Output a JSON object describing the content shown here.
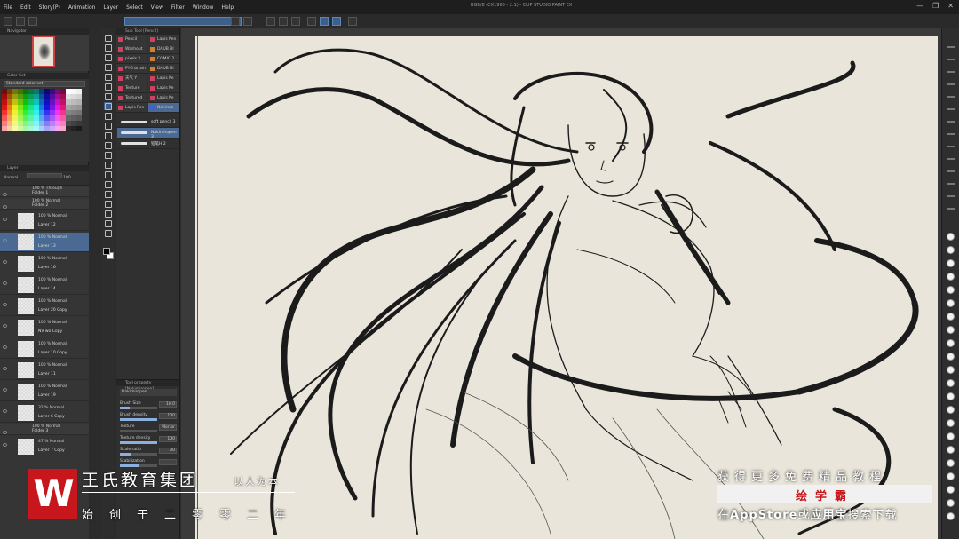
{
  "app": {
    "window_title": "RGB/8 (CX1966 - 2.1) - CLIP STUDIO PAINT EX",
    "menu": [
      "File",
      "Edit",
      "Story(P)",
      "Animation",
      "Layer",
      "Select",
      "View",
      "Filter",
      "Window",
      "Help"
    ],
    "window_controls": [
      "—",
      "❐",
      "✕"
    ]
  },
  "navigator": {
    "title": "Navigator"
  },
  "color_set": {
    "title": "Color Set",
    "selected_set": "Standard color set"
  },
  "layers_panel": {
    "title": "Layer",
    "blend_mode": "Normal",
    "opacity": "100",
    "layers": [
      {
        "blend": "100 % Through",
        "name": "Folder 1",
        "type": "folder"
      },
      {
        "blend": "100 % Normal",
        "name": "Folder 2",
        "type": "folder"
      },
      {
        "blend": "100 % Normal",
        "name": "Layer 12",
        "type": "layer"
      },
      {
        "blend": "100 % Normal",
        "name": "Layer 13",
        "type": "layer",
        "selected": true
      },
      {
        "blend": "100 % Normal",
        "name": "Layer 16",
        "type": "layer"
      },
      {
        "blend": "100 % Normal",
        "name": "Layer 14",
        "type": "layer"
      },
      {
        "blend": "100 % Normal",
        "name": "Layer 20 Copy",
        "type": "layer"
      },
      {
        "blend": "100 % Normal",
        "name": "NV wo Copy",
        "type": "layer"
      },
      {
        "blend": "100 % Normal",
        "name": "Layer 10 Copy",
        "type": "layer"
      },
      {
        "blend": "100 % Normal",
        "name": "Layer 11",
        "type": "layer"
      },
      {
        "blend": "100 % Normal",
        "name": "Layer 19",
        "type": "layer"
      },
      {
        "blend": "32 % Normal",
        "name": "Layer 6 Copy",
        "type": "layer"
      },
      {
        "blend": "100 % Normal",
        "name": "Folder 3",
        "type": "folder"
      },
      {
        "blend": "47 % Normal",
        "name": "Layer 7 Copy",
        "type": "layer"
      }
    ]
  },
  "sub_tool": {
    "title": "Sub Tool [Pencil]",
    "col_a": [
      {
        "label": "Pencil",
        "color": "#d04060"
      },
      {
        "label": "Washout",
        "color": "#d04060"
      },
      {
        "label": "pixels 2",
        "color": "#d04060"
      },
      {
        "label": "PYG brush",
        "color": "#d04060"
      },
      {
        "label": "天气 Y",
        "color": "#d04060"
      },
      {
        "label": "Texture",
        "color": "#d04060"
      },
      {
        "label": "Textured",
        "color": "#d04060"
      },
      {
        "label": "Lapis Pen",
        "color": "#d04060"
      }
    ],
    "col_b": [
      {
        "label": "Lapis Pen",
        "color": "#d04060"
      },
      {
        "label": "DAUB Bl",
        "color": "#d08030"
      },
      {
        "label": "COMIC 2",
        "color": "#d08030"
      },
      {
        "label": "DAUB Bl",
        "color": "#d08030"
      },
      {
        "label": "Lapis Pe",
        "color": "#d04060"
      },
      {
        "label": "Lapis Pe",
        "color": "#d04060"
      },
      {
        "label": "Lapis Pe",
        "color": "#d04060"
      },
      {
        "label": "Nakimiz",
        "color": "#4060d0"
      }
    ],
    "strokes": [
      {
        "name": "soft pencil 3"
      },
      {
        "name": "Nakimiropen 3"
      },
      {
        "name": "铅笔H 2"
      }
    ]
  },
  "tool_property": {
    "title": "Tool property [Nakimiropen]",
    "brush_name": "Nakimiropen",
    "rows": [
      {
        "label": "Brush Size",
        "value": "10.0",
        "fill": 0.25
      },
      {
        "label": "Brush density",
        "value": "100",
        "fill": 1.0
      },
      {
        "label": "Texture",
        "value": "Mortar",
        "fill": 0
      },
      {
        "label": "Texture density",
        "value": "100",
        "fill": 1.0
      },
      {
        "label": "Scale ratio",
        "value": "30",
        "fill": 0.3
      },
      {
        "label": "Stabilization",
        "value": "",
        "fill": 0.5
      }
    ]
  },
  "watermark": {
    "logo": "W",
    "company": "王氏教育集团",
    "motto": "以人为本",
    "since": "始创于二零零二年",
    "promo_line1": "获得更多免费精品教程",
    "promo_app": "绘学霸",
    "promo_line2_a": "在",
    "promo_line2_b": "AppStore",
    "promo_line2_c": "或",
    "promo_line2_d": "应用宝",
    "promo_line2_e": "搜索下载",
    "brand_red": "#c8161d"
  }
}
